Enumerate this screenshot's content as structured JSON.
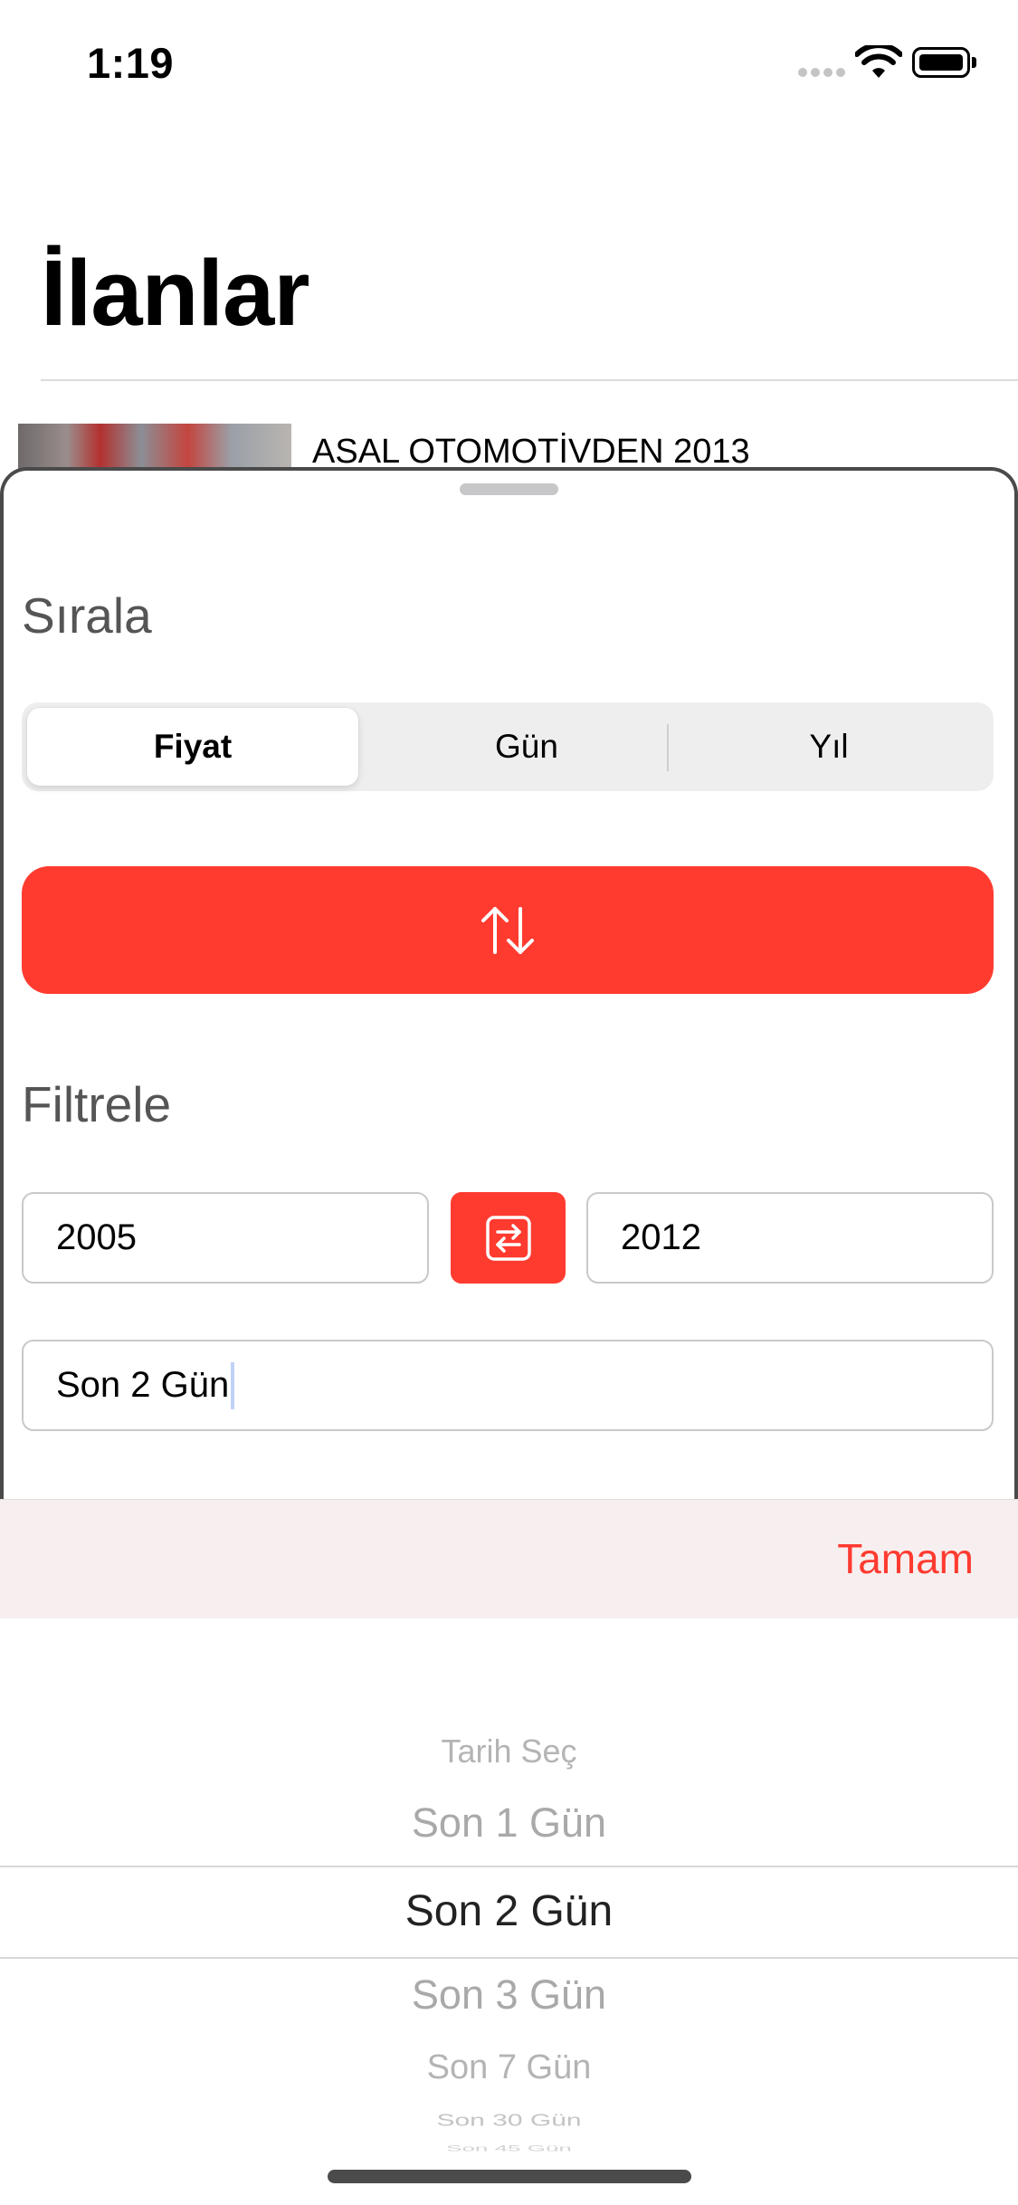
{
  "status_bar": {
    "time": "1:19"
  },
  "page": {
    "title": "İlanlar",
    "listing_title": "ASAL OTOMOTİVDEN 2013"
  },
  "sheet": {
    "sort": {
      "heading": "Sırala",
      "segments": [
        "Fiyat",
        "Gün",
        "Yıl"
      ],
      "selected": "Fiyat"
    },
    "filter": {
      "heading": "Filtrele",
      "year_from": "2005",
      "year_to": "2012",
      "days_value": "Son 2 Gün"
    }
  },
  "picker": {
    "done_label": "Tamam",
    "options": [
      "Tarih Seç",
      "Son 1 Gün",
      "Son 2 Gün",
      "Son 3 Gün",
      "Son 7 Gün",
      "Son 30 Gün",
      "Son 45 Gün"
    ],
    "selected": "Son 2 Gün"
  },
  "colors": {
    "accent": "#ff3b30",
    "text": "#000000",
    "heading": "#555555"
  },
  "icons": {
    "sort_direction": "arrows-up-down-icon",
    "swap_years": "swap-horizontal-icon",
    "wifi": "wifi-icon",
    "battery": "battery-icon",
    "signal": "cellular-signal-icon"
  }
}
